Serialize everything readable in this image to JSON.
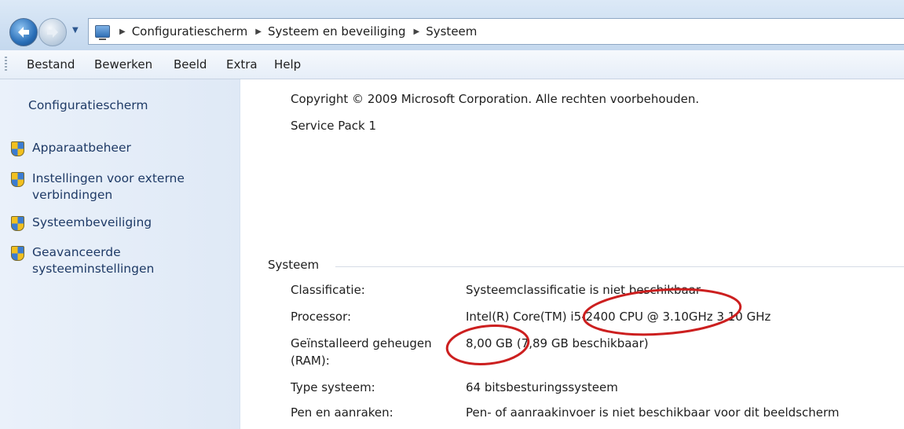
{
  "breadcrumb": {
    "items": [
      "Configuratiescherm",
      "Systeem en beveiliging",
      "Systeem"
    ]
  },
  "menu": {
    "items": [
      "Bestand",
      "Bewerken",
      "Beeld",
      "Extra",
      "Help"
    ]
  },
  "sidebar": {
    "title": "Configuratiescherm",
    "items": [
      {
        "label": "Apparaatbeheer"
      },
      {
        "label": "Instellingen voor externe verbindingen"
      },
      {
        "label": "Systeembeveiliging"
      },
      {
        "label": "Geavanceerde systeeminstellingen"
      }
    ]
  },
  "main": {
    "copyright": "Copyright © 2009 Microsoft Corporation. Alle rechten voorbehouden.",
    "service_pack": "Service Pack 1",
    "system_group": {
      "title": "Systeem",
      "rows": [
        {
          "label": "Classificatie:",
          "value": "Systeemclassificatie is niet beschikbaar"
        },
        {
          "label": "Processor:",
          "value": "Intel(R) Core(TM) i5-2400 CPU @ 3.10GHz   3.10 GHz"
        },
        {
          "label": "Geïnstalleerd geheugen (RAM):",
          "value": "8,00 GB (7,89 GB beschikbaar)"
        },
        {
          "label": "Type systeem:",
          "value": "64 bitsbesturingssysteem"
        },
        {
          "label": "Pen en aanraken:",
          "value": "Pen- of aanraakinvoer is niet beschikbaar voor dit beeldscherm"
        }
      ]
    }
  },
  "icons": {
    "back": "back-arrow-icon",
    "forward": "forward-arrow-icon",
    "computer": "computer-icon",
    "shield": "uac-shield-icon"
  },
  "colors": {
    "link": "#1f5aa8",
    "annotation": "#cc1f1f"
  }
}
